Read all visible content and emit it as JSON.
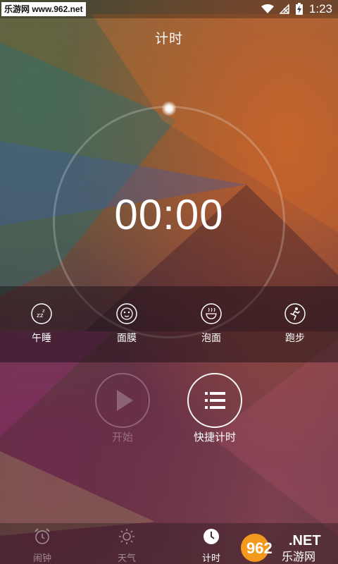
{
  "status_bar": {
    "watermark": "乐游网 www.962.net",
    "time": "1:23"
  },
  "header": {
    "title": "计时"
  },
  "timer": {
    "display": "00:00"
  },
  "presets": [
    {
      "label": "午睡",
      "icon": "nap-icon"
    },
    {
      "label": "面膜",
      "icon": "face-mask-icon"
    },
    {
      "label": "泡面",
      "icon": "noodle-bowl-icon"
    },
    {
      "label": "跑步",
      "icon": "running-icon"
    }
  ],
  "controls": {
    "start_label": "开始",
    "quick_label": "快捷计时"
  },
  "bottom_nav": {
    "items": [
      {
        "label": "闹钟",
        "icon": "alarm-clock-icon",
        "active": false
      },
      {
        "label": "天气",
        "icon": "sun-icon",
        "active": false
      },
      {
        "label": "计时",
        "icon": "timer-icon",
        "active": true
      }
    ]
  },
  "brand_logo": {
    "text_top": "962.NET",
    "text_bottom": "乐游网"
  },
  "colors": {
    "accent": "#ffffff",
    "inactive": "rgba(255,255,255,0.35)"
  }
}
